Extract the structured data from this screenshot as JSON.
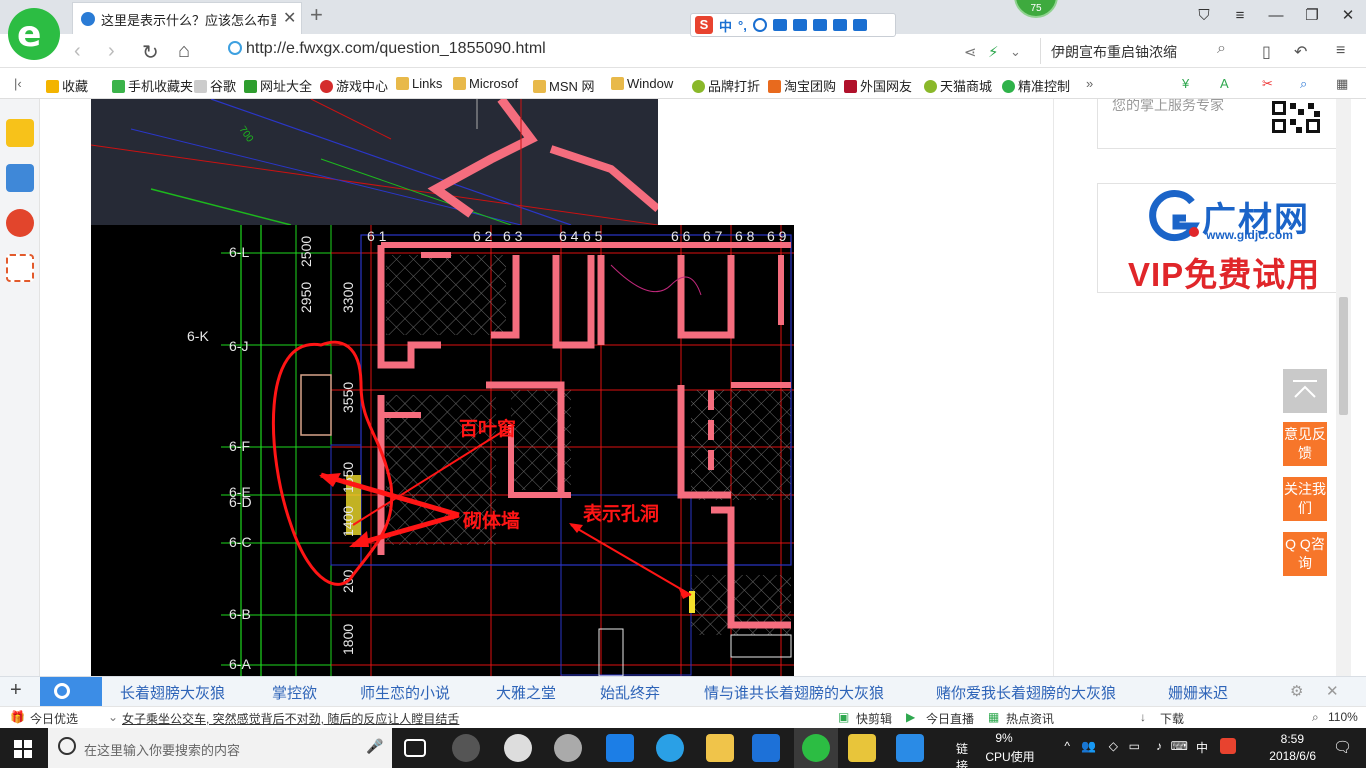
{
  "browser": {
    "tab_title": "这里是表示什么？应该怎么布置呢",
    "url": "http://e.fwxgx.com/question_1855090.html",
    "search_box": "伊朗宣布重启铀浓缩",
    "badge_number": "75",
    "ime_label": "中"
  },
  "bookmarks": [
    {
      "label": "收藏",
      "color": "#f3b400"
    },
    {
      "label": "手机收藏夹",
      "color": "#3bb34a"
    },
    {
      "label": "谷歌",
      "color": "#999999"
    },
    {
      "label": "网址大全",
      "color": "#2f9e2f"
    },
    {
      "label": "游戏中心",
      "color": "#d42c2c"
    },
    {
      "label": "Links",
      "color": "#e8b94a"
    },
    {
      "label": "Microsof",
      "color": "#e8b94a"
    },
    {
      "label": "MSN 网",
      "color": "#e8b94a"
    },
    {
      "label": "Window",
      "color": "#e8b94a"
    },
    {
      "label": "品牌打折",
      "color": "#8ab82a"
    },
    {
      "label": "淘宝团购",
      "color": "#e86a1e"
    },
    {
      "label": "外国网友",
      "color": "#b0112b"
    },
    {
      "label": "天猫商城",
      "color": "#8ab82a"
    },
    {
      "label": "精准控制",
      "color": "#2fb24a"
    }
  ],
  "drawing": {
    "grid_labels_left": [
      "6-L",
      "6-J",
      "6-K",
      "6-F",
      "6-E",
      "6-D",
      "6-C",
      "6-B",
      "6-A"
    ],
    "top_labels": [
      "6 1",
      "6 2",
      "6 3",
      "6 4",
      "6 5",
      "6 6",
      "6 7",
      "6 8",
      "6 9"
    ],
    "dims_vertical": [
      "2950",
      "3300",
      "3550",
      "1550",
      "1400",
      "200",
      "1800",
      "2500"
    ],
    "dim_top": "700",
    "annotation_window": "百叶窗",
    "annotation_wall": "砌体墙",
    "annotation_hole": "表示孔洞"
  },
  "sidebar": {
    "promo1_text": "您的掌上服务专家",
    "promo2_name": "广材网",
    "promo2_url": "www.gldjc.com",
    "promo2_vip": "VIP免费试用",
    "float_feedback": "意见反馈",
    "float_follow": "关注我们",
    "float_qq": "Q Q咨询"
  },
  "hotwords": [
    "长着翅膀大灰狼",
    "掌控欲",
    "师生恋的小说",
    "大雅之堂",
    "始乱终弃",
    "情与谁共长着翅膀的大灰狼",
    "赌你爱我长着翅膀的大灰狼",
    "姗姗来迟"
  ],
  "statusbar": {
    "today": "今日优选",
    "news": "女子乘坐公交车, 突然感觉背后不对劲, 随后的反应让人瞠目结舌",
    "quick_cut": "快剪辑",
    "live": "今日直播",
    "hot": "热点资讯",
    "download": "下载",
    "zoom": "110%"
  },
  "taskbar": {
    "search_placeholder": "在这里输入你要搜索的内容",
    "link_label": "链接",
    "cpu_percent": "9%",
    "cpu_label": "CPU使用",
    "ime": "中",
    "time": "8:59",
    "date": "2018/6/6"
  }
}
